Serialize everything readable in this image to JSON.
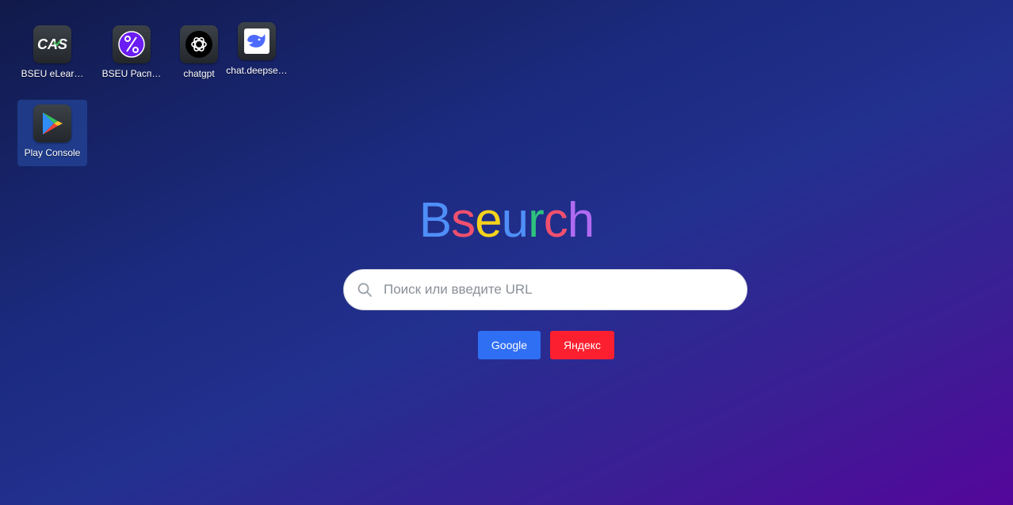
{
  "shortcuts": [
    {
      "label": "BSEU eLear…",
      "icon": "cas-logo-icon"
    },
    {
      "label": "BSEU Расп…",
      "icon": "bseu-schedule-icon"
    },
    {
      "label": "chatgpt",
      "icon": "openai-logo-icon"
    },
    {
      "label": "chat.deepse…",
      "icon": "deepseek-whale-icon"
    },
    {
      "label": "Play Console",
      "icon": "google-play-icon"
    }
  ],
  "logo": {
    "letters": [
      "B",
      "s",
      "e",
      "u",
      "r",
      "c",
      "h"
    ],
    "colors": [
      "#4f8ef7",
      "#f0506e",
      "#f5d21c",
      "#4f8ef7",
      "#2ec27e",
      "#f0506e",
      "#b06bf2"
    ]
  },
  "search": {
    "placeholder": "Поиск или введите URL"
  },
  "engines": {
    "google_label": "Google",
    "google_color": "#2f6ff4",
    "yandex_label": "Яндекс",
    "yandex_color": "#fb1f2f"
  }
}
